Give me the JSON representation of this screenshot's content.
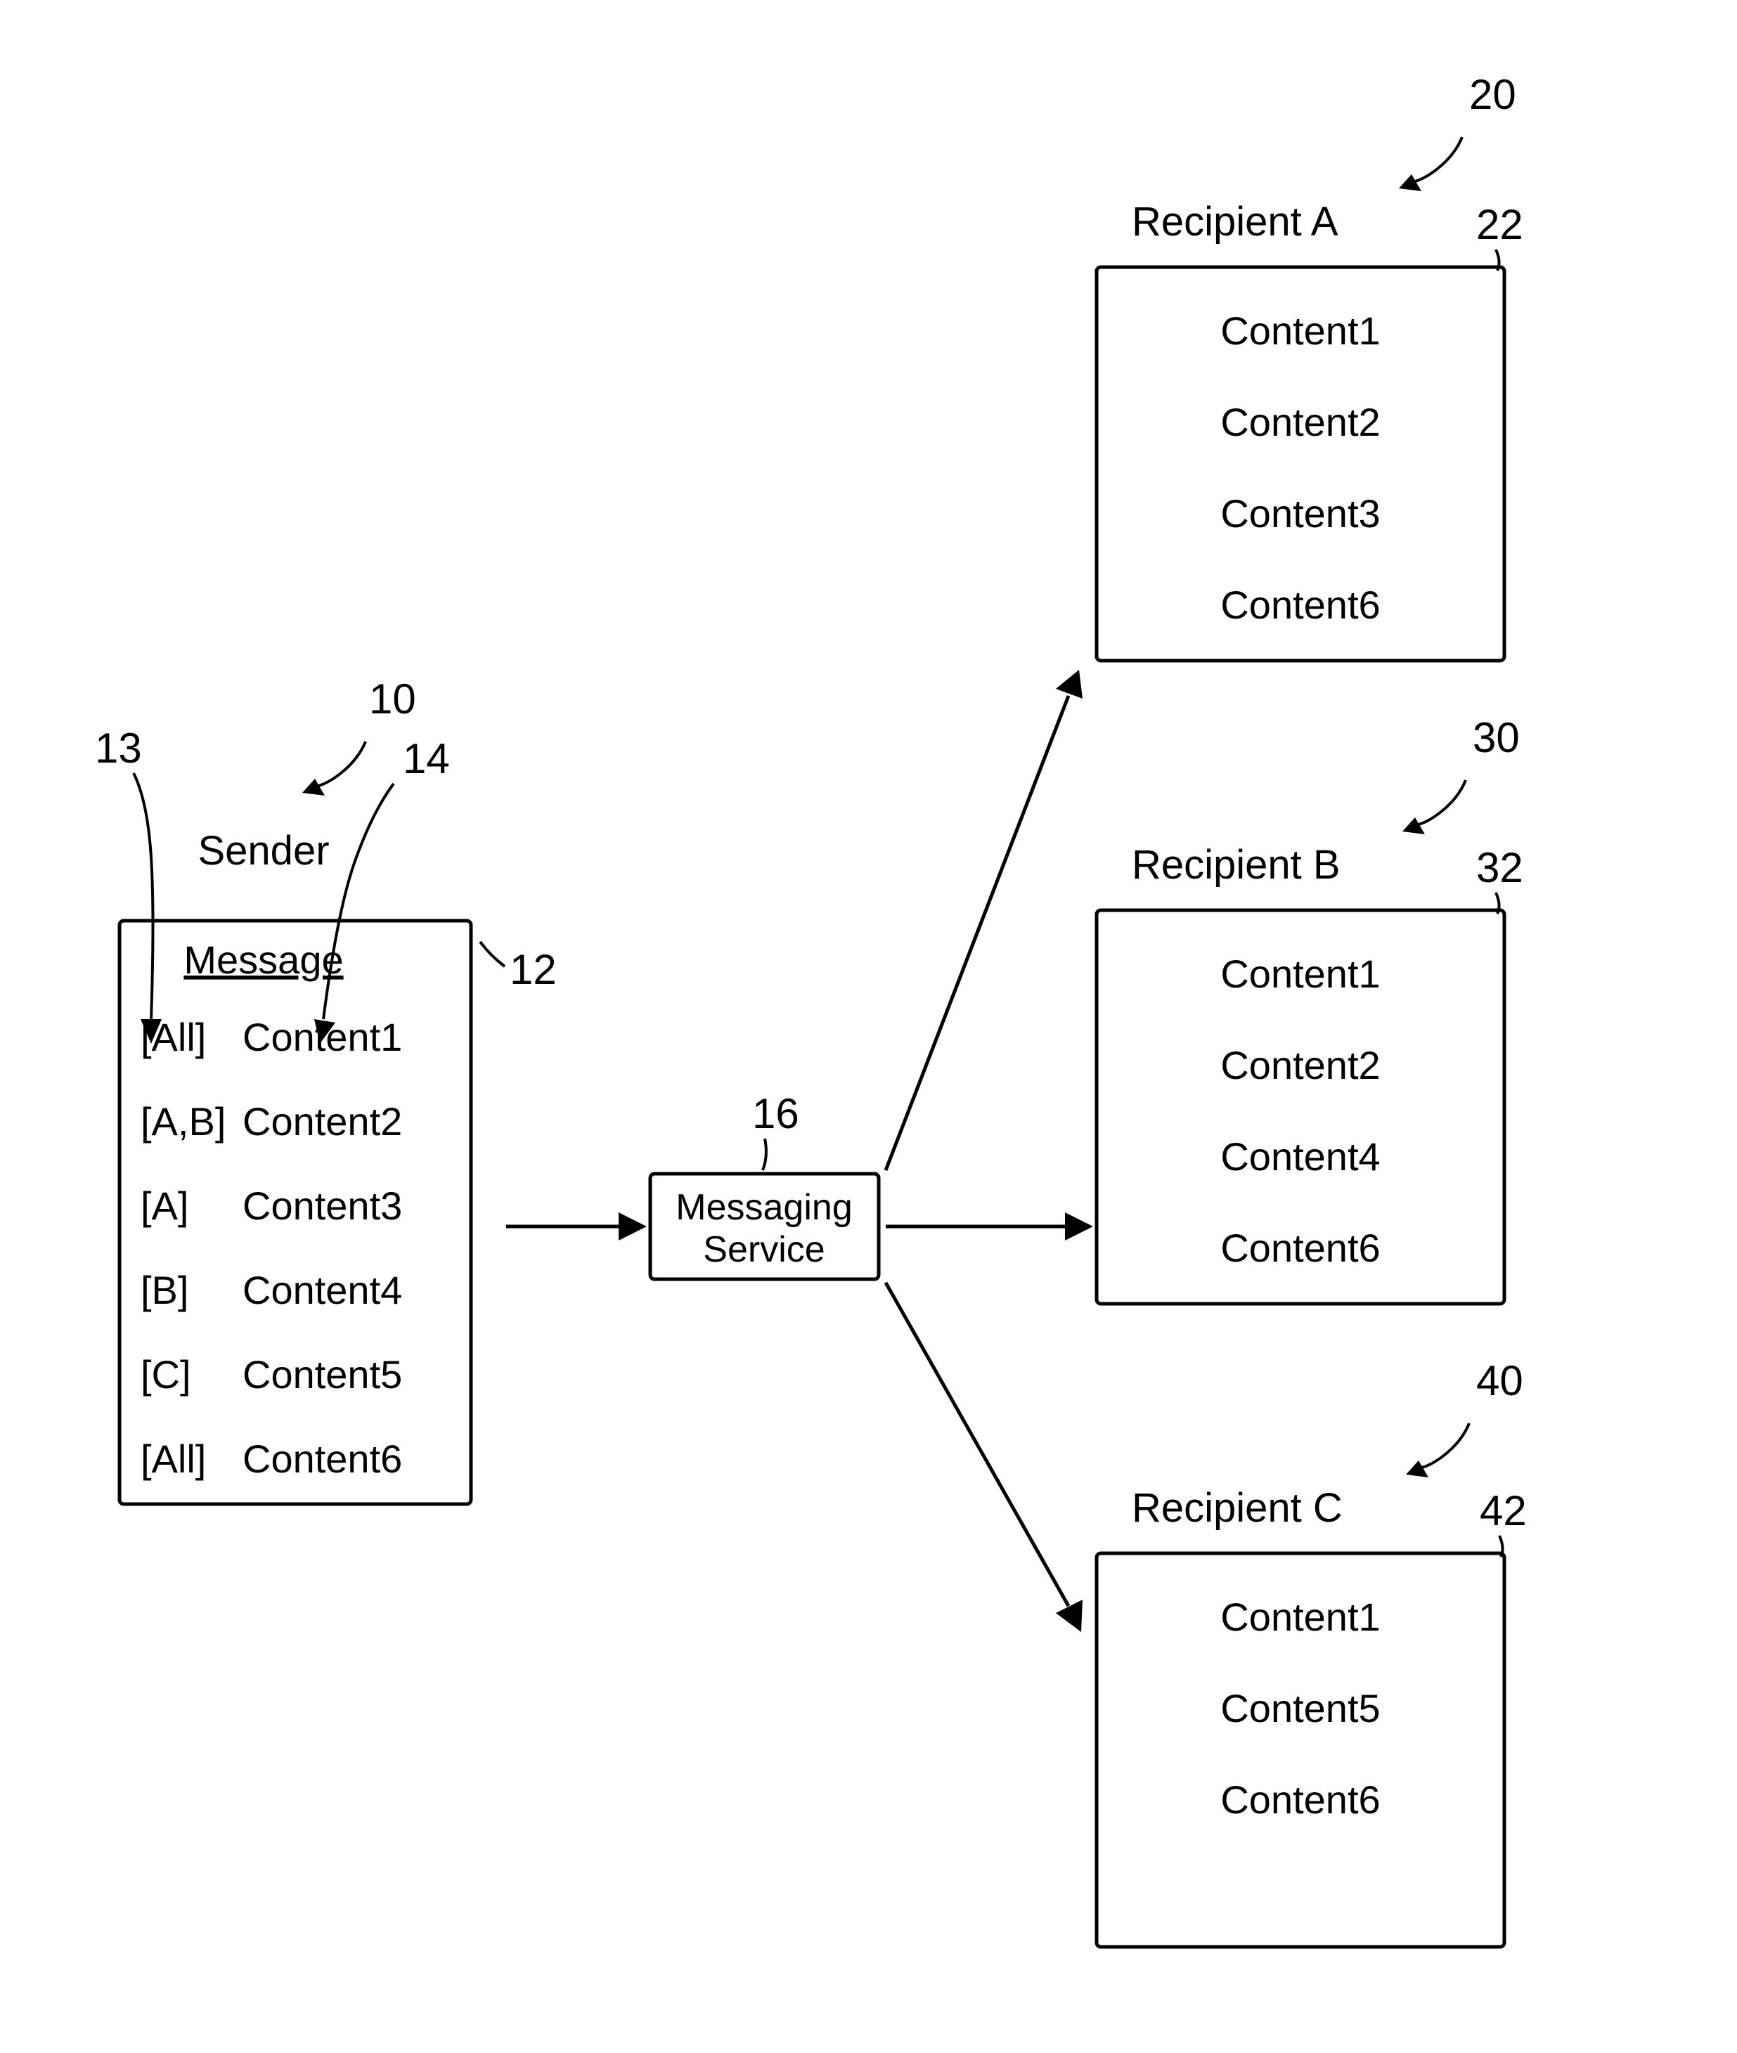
{
  "sender": {
    "title": "Sender",
    "message_heading": "Message",
    "rows": [
      {
        "tag": "[All]",
        "content": "Content1"
      },
      {
        "tag": "[A,B]",
        "content": "Content2"
      },
      {
        "tag": "[A]",
        "content": "Content3"
      },
      {
        "tag": "[B]",
        "content": "Content4"
      },
      {
        "tag": "[C]",
        "content": "Content5"
      },
      {
        "tag": "[All]",
        "content": "Content6"
      }
    ]
  },
  "service": {
    "line1": "Messaging",
    "line2": "Service"
  },
  "recipients": {
    "a": {
      "title": "Recipient A",
      "items": [
        "Content1",
        "Content2",
        "Content3",
        "Content6"
      ]
    },
    "b": {
      "title": "Recipient B",
      "items": [
        "Content1",
        "Content2",
        "Content4",
        "Content6"
      ]
    },
    "c": {
      "title": "Recipient C",
      "items": [
        "Content1",
        "Content5",
        "Content6"
      ]
    }
  },
  "refs": {
    "r10": "10",
    "r12": "12",
    "r13": "13",
    "r14": "14",
    "r16": "16",
    "r20": "20",
    "r22": "22",
    "r30": "30",
    "r32": "32",
    "r40": "40",
    "r42": "42"
  }
}
